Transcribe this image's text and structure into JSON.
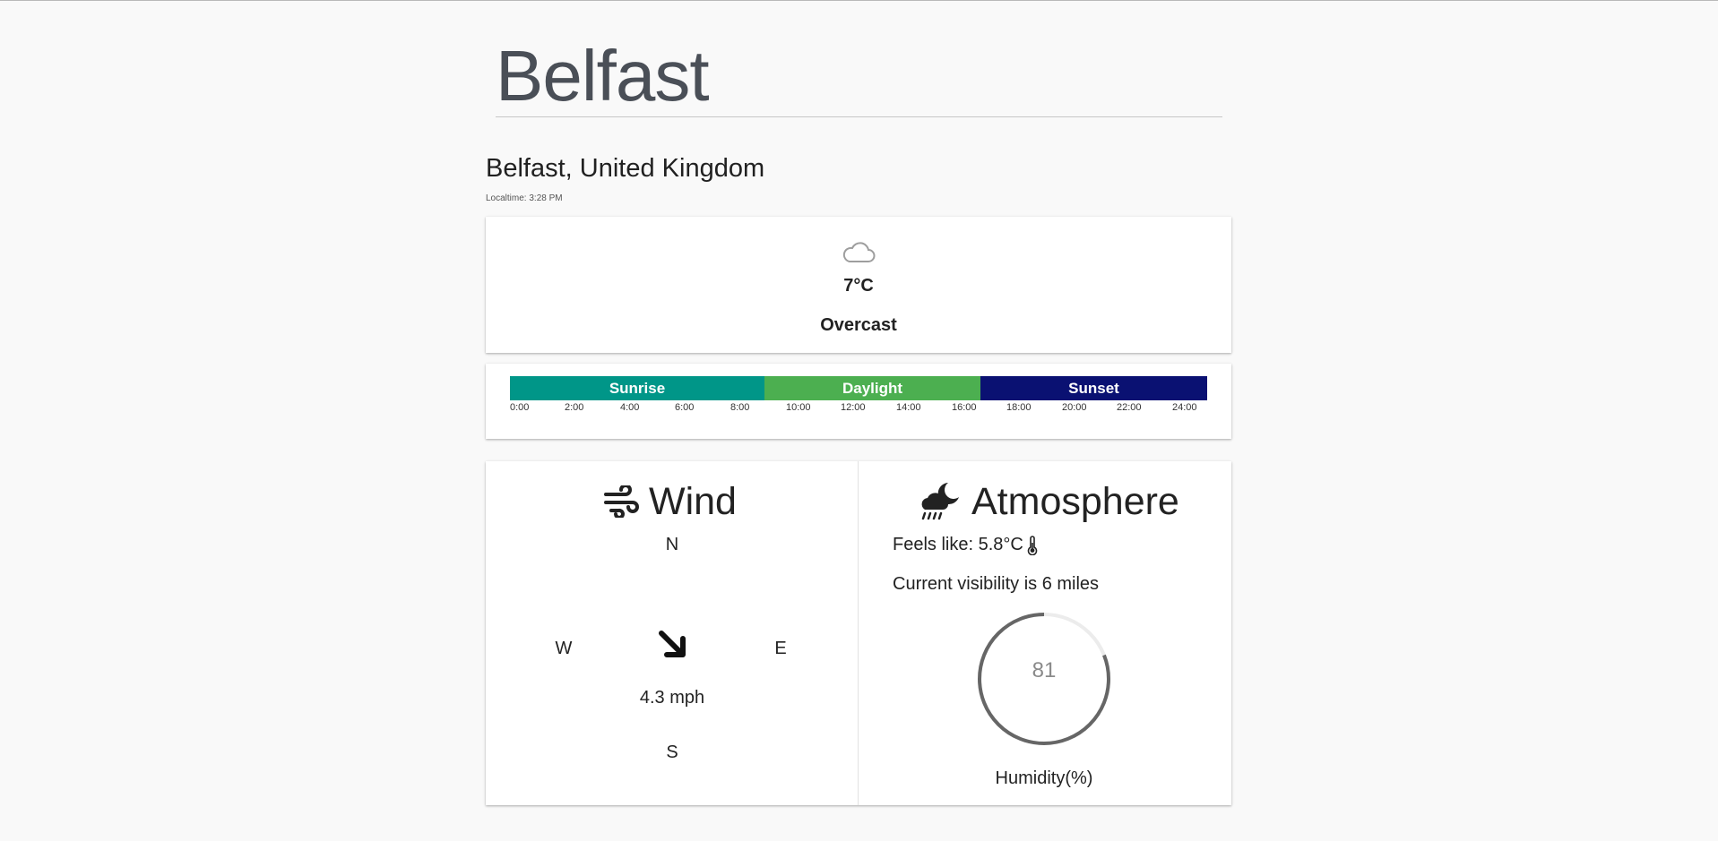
{
  "page": {
    "title": "Belfast"
  },
  "location": {
    "name": "Belfast, United Kingdom",
    "localtime": "Localtime: 3:28 PM"
  },
  "current": {
    "icon": "cloud-icon",
    "temperature": "7°C",
    "condition": "Overcast"
  },
  "daytimeline": {
    "segments": [
      {
        "label": "Sunrise",
        "color": "#009688"
      },
      {
        "label": "Daylight",
        "color": "#4caf50"
      },
      {
        "label": "Sunset",
        "color": "#0a1172"
      }
    ],
    "ticks": [
      "0:00",
      "2:00",
      "4:00",
      "6:00",
      "8:00",
      "10:00",
      "12:00",
      "14:00",
      "16:00",
      "18:00",
      "20:00",
      "22:00",
      "24:00"
    ]
  },
  "wind": {
    "heading": "Wind",
    "icon": "wind-icon",
    "north": "N",
    "south": "S",
    "east": "E",
    "west": "W",
    "direction_icon": "arrow-down-right-icon",
    "speed": "4.3 mph"
  },
  "atmosphere": {
    "heading": "Atmosphere",
    "icon": "night-rain-icon",
    "feels_like": "Feels like: 5.8°C",
    "feels_like_icon": "thermometer-icon",
    "visibility": "Current visibility is 6 miles",
    "humidity_value": "81",
    "humidity_fraction": 0.81,
    "humidity_label": "Humidity(%)"
  }
}
